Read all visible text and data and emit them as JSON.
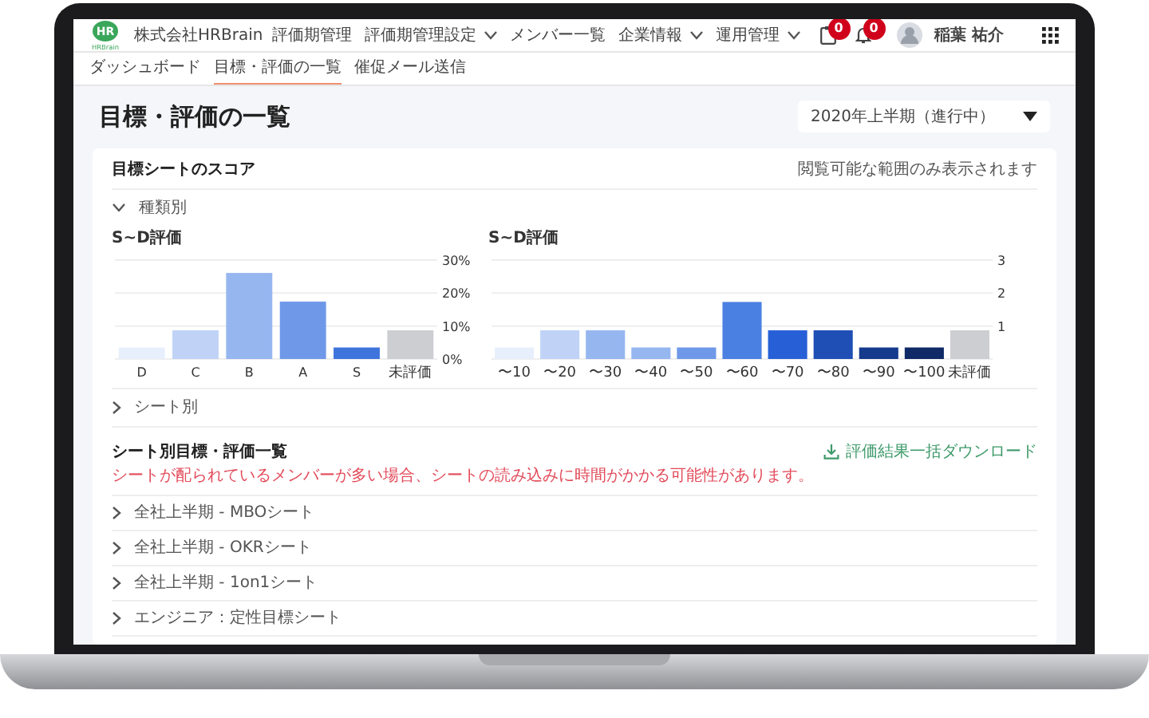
{
  "header": {
    "logo": {
      "mark": "HR",
      "caption": "HRBrain"
    },
    "company": "株式会社HRBrain",
    "nav": [
      {
        "label": "評価期管理",
        "dropdown": false
      },
      {
        "label": "評価期管理設定",
        "dropdown": true
      },
      {
        "label": "メンバー一覧",
        "dropdown": false
      },
      {
        "label": "企業情報",
        "dropdown": true
      },
      {
        "label": "運用管理",
        "dropdown": true
      }
    ],
    "notifications": [
      {
        "kind": "clipboard",
        "badge": "0"
      },
      {
        "kind": "bell",
        "badge": "0"
      }
    ],
    "user": {
      "name": "稲葉 祐介"
    }
  },
  "tabs": [
    {
      "label": "ダッシュボード",
      "selected": false
    },
    {
      "label": "目標・評価の一覧",
      "selected": true
    },
    {
      "label": "催促メール送信",
      "selected": false
    }
  ],
  "page": {
    "title": "目標・評価の一覧",
    "period_select": {
      "value": "2020年上半期（進行中）"
    }
  },
  "score_card": {
    "title": "目標シートのスコア",
    "note": "閲覧可能な範囲のみ表示されます",
    "groups": [
      {
        "label": "種類別",
        "expanded": true,
        "charts": [
          {
            "title": "S~D評価",
            "chart_data": {
              "type": "bar",
              "categories": [
                "D",
                "C",
                "B",
                "A",
                "S",
                "未評価"
              ],
              "values": [
                3.5,
                8.7,
                26.1,
                17.4,
                3.5,
                8.7
              ],
              "colors": [
                "#e8effc",
                "#c0d3f7",
                "#96b6f0",
                "#6f99e8",
                "#3f74dd",
                "#cdced2"
              ],
              "ylim": [
                0,
                30
              ],
              "yticks": [
                {
                  "value": 0,
                  "label": "0%"
                },
                {
                  "value": 10,
                  "label": "10%"
                },
                {
                  "value": 20,
                  "label": "20%"
                },
                {
                  "value": 30,
                  "label": "30%"
                }
              ]
            }
          },
          {
            "title": "S~D評価",
            "chart_data": {
              "type": "bar",
              "categories": [
                "〜10",
                "〜20",
                "〜30",
                "〜40",
                "〜50",
                "〜60",
                "〜70",
                "〜80",
                "〜90",
                "〜100",
                "未評価"
              ],
              "values": [
                0.35,
                0.87,
                0.87,
                0.35,
                0.35,
                1.73,
                0.87,
                0.87,
                0.35,
                0.35,
                0.87
              ],
              "colors": [
                "#e8effc",
                "#c0d3f7",
                "#96b6f0",
                "#96b6f0",
                "#6f99e8",
                "#4a80e2",
                "#2760d6",
                "#1f4fb5",
                "#163a8c",
                "#0f2a66",
                "#cdced2"
              ],
              "ylim": [
                0,
                3
              ],
              "yticks": [
                {
                  "value": 1,
                  "label": "1"
                },
                {
                  "value": 2,
                  "label": "2"
                },
                {
                  "value": 3,
                  "label": "3"
                }
              ]
            }
          }
        ]
      },
      {
        "label": "シート別",
        "expanded": false
      }
    ]
  },
  "sheet_list": {
    "title": "シート別目標・評価一覧",
    "download": "評価結果一括ダウンロード",
    "warning": "シートが配られているメンバーが多い場合、シートの読み込みに時間がかかる可能性があります。",
    "items": [
      {
        "label": "全社上半期 - MBOシート",
        "expanded": false
      },
      {
        "label": "全社上半期 - OKRシート",
        "expanded": false
      },
      {
        "label": "全社上半期 - 1on1シート",
        "expanded": false
      },
      {
        "label": "エンジニア：定性目標シート",
        "expanded": false
      }
    ]
  }
}
